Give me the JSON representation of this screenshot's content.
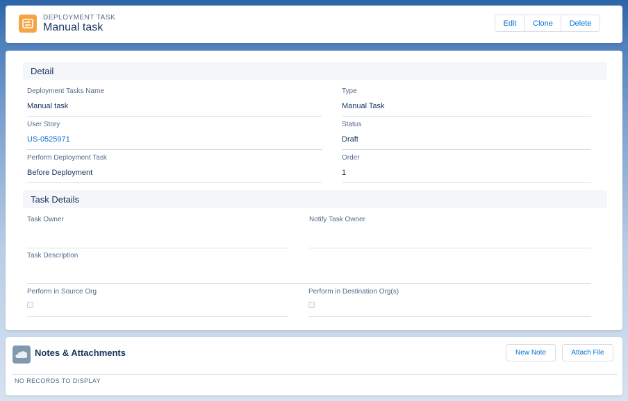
{
  "header": {
    "object_type": "DEPLOYMENT TASK",
    "title": "Manual task",
    "icon": "deployment-task-icon",
    "icon_color": "#f6a545",
    "actions": [
      "Edit",
      "Clone",
      "Delete"
    ]
  },
  "detail_section": {
    "title": "Detail",
    "fields": {
      "deployment_tasks_name": {
        "label": "Deployment Tasks Name",
        "value": "Manual task"
      },
      "type": {
        "label": "Type",
        "value": "Manual Task"
      },
      "user_story": {
        "label": "User Story",
        "value": "US-0525971"
      },
      "status": {
        "label": "Status",
        "value": "Draft"
      },
      "perform_deployment_task": {
        "label": "Perform Deployment Task",
        "value": "Before Deployment"
      },
      "order": {
        "label": "Order",
        "value": "1"
      }
    }
  },
  "task_details_section": {
    "title": "Task Details",
    "fields": {
      "task_owner": {
        "label": "Task Owner",
        "value": ""
      },
      "notify_task_owner": {
        "label": "Notify Task Owner",
        "value": ""
      },
      "task_description": {
        "label": "Task Description",
        "value": ""
      },
      "perform_in_source_org": {
        "label": "Perform in Source Org",
        "checked": false
      },
      "perform_in_destination_orgs": {
        "label": "Perform in Destination Org(s)",
        "checked": false
      }
    }
  },
  "notes": {
    "title": "Notes & Attachments",
    "icon": "notes-icon",
    "icon_color": "#8199af",
    "new_note_label": "New Note",
    "attach_file_label": "Attach File",
    "empty_text": "NO RECORDS TO DISPLAY"
  },
  "colors": {
    "link": "#0070d2",
    "text": "#16325c",
    "label": "#54698d"
  }
}
